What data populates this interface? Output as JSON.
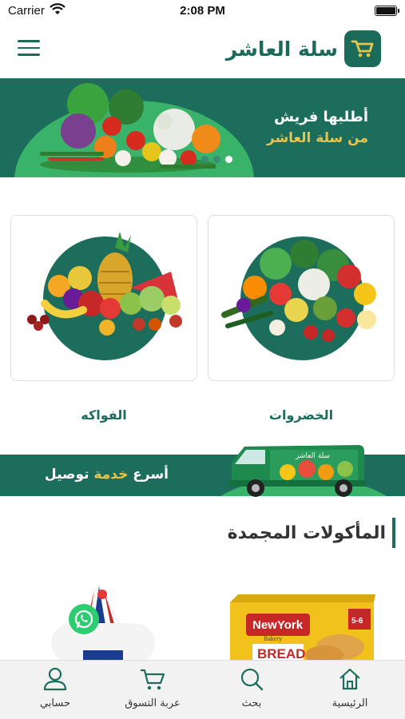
{
  "status_bar": {
    "carrier": "Carrier",
    "time": "2:08 PM"
  },
  "header": {
    "brand_name": "سلة العاشر",
    "logo_icon": "basket-icon",
    "menu_icon": "hamburger-icon"
  },
  "hero": {
    "line1": "أطلبها فريش",
    "line2": "من سلة العاشر",
    "colors": {
      "bg": "#1d6d5c",
      "accent": "#e8c54a",
      "light": "#39b26a"
    }
  },
  "categories": [
    {
      "label": "الخضروات"
    },
    {
      "label": "الفواكه"
    }
  ],
  "delivery": {
    "part1": "أسرع",
    "accent": "خدمة",
    "part2": "توصيل",
    "van_text": "سلة العاشر"
  },
  "section": {
    "title": "المأكولات المجمدة"
  },
  "product": {
    "brand": "NewYork",
    "sub": "Bakery",
    "name": "BREAD",
    "badge": "5-6"
  },
  "nav": {
    "home": "الرئيسية",
    "search": "بحث",
    "cart": "عربة التسوق",
    "account": "حسابي"
  }
}
